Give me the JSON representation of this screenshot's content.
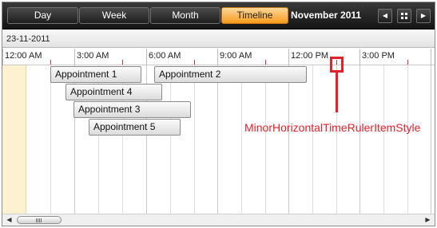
{
  "toolbar": {
    "views": [
      "Day",
      "Week",
      "Month",
      "Timeline"
    ],
    "active_view": "Timeline",
    "month_title": "November 2011",
    "prev_glyph": "◀",
    "next_glyph": "▶",
    "calendar_icon": "grid-icon"
  },
  "date_header": {
    "date": "23-11-2011"
  },
  "ruler": {
    "labels": [
      "12:00 AM",
      "3:00 AM",
      "6:00 AM",
      "9:00 AM",
      "12:00 PM",
      "3:00 PM"
    ]
  },
  "appointments": [
    "Appointment 1",
    "Appointment 2",
    "Appointment 4",
    "Appointment 3",
    "Appointment 5"
  ],
  "callout": {
    "label": "MinorHorizontalTimeRulerItemStyle",
    "color": "#e8202a"
  },
  "scrollbar": {
    "left_arrow": "◀",
    "right_arrow": "▶"
  },
  "colors": {
    "active_tab": "#f59a1c",
    "offhours": "#fdf1cf",
    "toolbar": "#1e1e1e"
  }
}
